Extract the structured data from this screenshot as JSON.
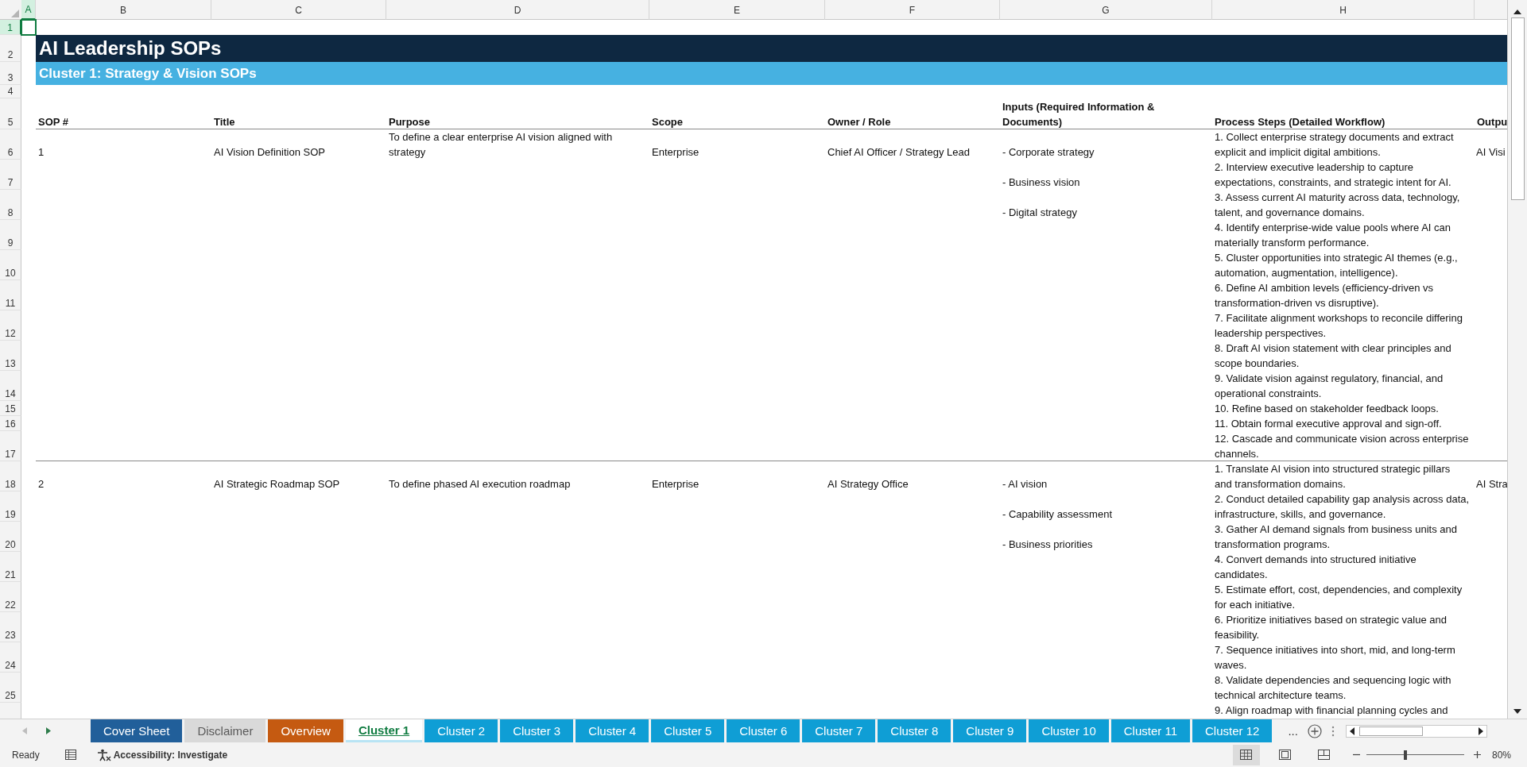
{
  "columns": [
    {
      "label": "A",
      "selected": true
    },
    {
      "label": "B",
      "selected": false
    },
    {
      "label": "C",
      "selected": false
    },
    {
      "label": "D",
      "selected": false
    },
    {
      "label": "E",
      "selected": false
    },
    {
      "label": "F",
      "selected": false
    },
    {
      "label": "G",
      "selected": false
    },
    {
      "label": "H",
      "selected": false
    }
  ],
  "rows": [
    {
      "label": "1",
      "selected": true
    },
    {
      "label": "2",
      "selected": false
    },
    {
      "label": "3",
      "selected": false
    },
    {
      "label": "4",
      "selected": false
    },
    {
      "label": "5",
      "selected": false
    },
    {
      "label": "6",
      "selected": false
    },
    {
      "label": "7",
      "selected": false
    },
    {
      "label": "8",
      "selected": false
    },
    {
      "label": "9",
      "selected": false
    },
    {
      "label": "10",
      "selected": false
    },
    {
      "label": "11",
      "selected": false
    },
    {
      "label": "12",
      "selected": false
    },
    {
      "label": "13",
      "selected": false
    },
    {
      "label": "14",
      "selected": false
    },
    {
      "label": "15",
      "selected": false
    },
    {
      "label": "16",
      "selected": false
    },
    {
      "label": "17",
      "selected": false
    },
    {
      "label": "18",
      "selected": false
    },
    {
      "label": "19",
      "selected": false
    },
    {
      "label": "20",
      "selected": false
    },
    {
      "label": "21",
      "selected": false
    },
    {
      "label": "22",
      "selected": false
    },
    {
      "label": "23",
      "selected": false
    },
    {
      "label": "24",
      "selected": false
    },
    {
      "label": "25",
      "selected": false
    }
  ],
  "title": "AI Leadership SOPs",
  "subtitle": "Cluster 1: Strategy & Vision SOPs",
  "table": {
    "columns": [
      "SOP #",
      "Title",
      "Purpose",
      "Scope",
      "Owner / Role",
      "Inputs (Required Information & Documents)",
      "Process Steps (Detailed Workflow)",
      "Outpu"
    ],
    "records": [
      {
        "sop": "1",
        "title": "AI Vision Definition SOP",
        "purpose": "To define a clear enterprise AI vision aligned with strategy",
        "scope": "Enterprise",
        "owner": "Chief AI Officer / Strategy Lead",
        "inputs": [
          "- Corporate strategy",
          "- Business vision",
          "- Digital strategy"
        ],
        "steps": [
          "1. Collect enterprise strategy documents and extract explicit and implicit digital ambitions.",
          "2. Interview executive leadership to capture expectations, constraints, and strategic intent for AI.",
          "3. Assess current AI maturity across data, technology, talent, and governance domains.",
          "4. Identify enterprise-wide value pools where AI can materially transform performance.",
          "5. Cluster opportunities into strategic AI themes (e.g., automation, augmentation, intelligence).",
          "6. Define AI ambition levels (efficiency-driven vs transformation-driven vs disruptive).",
          "7. Facilitate alignment workshops to reconcile differing leadership perspectives.",
          "8. Draft AI vision statement with clear principles and scope boundaries.",
          "9. Validate vision against regulatory, financial, and operational constraints.",
          "10. Refine based on stakeholder feedback loops.",
          "11. Obtain formal executive approval and sign-off.",
          "12. Cascade and communicate vision across enterprise channels."
        ],
        "column_9": "AI Visi"
      },
      {
        "sop": "2",
        "title": "AI Strategic Roadmap SOP",
        "purpose": "To define phased AI execution roadmap",
        "scope": "Enterprise",
        "owner": "AI Strategy Office",
        "inputs": [
          "- AI vision",
          "- Capability assessment",
          "- Business priorities"
        ],
        "steps": [
          "1. Translate AI vision into structured strategic pillars and transformation domains.",
          "2. Conduct detailed capability gap analysis across data, infrastructure, skills, and governance.",
          "3. Gather AI demand signals from business units and transformation programs.",
          "4. Convert demands into structured initiative candidates.",
          "5. Estimate effort, cost, dependencies, and complexity for each initiative.",
          "6. Prioritize initiatives based on strategic value and feasibility.",
          "7. Sequence initiatives into short, mid, and long-term waves.",
          "8. Validate dependencies and sequencing logic with technical architecture teams.",
          "9. Align roadmap with financial planning cycles and"
        ],
        "column_9": "AI Stra"
      }
    ]
  },
  "sheet_tabs": [
    {
      "label": "Cover Sheet",
      "color": "#215f9a",
      "selected": false
    },
    {
      "label": "Disclaimer",
      "color": "#d9d9d9",
      "selected": false
    },
    {
      "label": "Overview",
      "color": "#c55a11",
      "selected": false
    },
    {
      "label": "Cluster 1",
      "color": "#b8e4f4",
      "selected": true
    },
    {
      "label": "Cluster 2",
      "color": "#0f9ed5",
      "selected": false
    },
    {
      "label": "Cluster 3",
      "color": "#0f9ed5",
      "selected": false
    },
    {
      "label": "Cluster 4",
      "color": "#0f9ed5",
      "selected": false
    },
    {
      "label": "Cluster 5",
      "color": "#0f9ed5",
      "selected": false
    },
    {
      "label": "Cluster 6",
      "color": "#0f9ed5",
      "selected": false
    },
    {
      "label": "Cluster 7",
      "color": "#0f9ed5",
      "selected": false
    },
    {
      "label": "Cluster 8",
      "color": "#0f9ed5",
      "selected": false
    },
    {
      "label": "Cluster 9",
      "color": "#0f9ed5",
      "selected": false
    },
    {
      "label": "Cluster 10",
      "color": "#0f9ed5",
      "selected": false
    },
    {
      "label": "Cluster 11",
      "color": "#0f9ed5",
      "selected": false
    },
    {
      "label": "Cluster 12",
      "color": "#0f9ed5",
      "selected": false
    }
  ],
  "more_tabs": "...",
  "status_bar": {
    "status": "Ready",
    "accessibility": "Accessibility: Investigate",
    "views": [
      {
        "kind": "normal",
        "selected": true
      },
      {
        "kind": "page_layout",
        "selected": false
      },
      {
        "kind": "page_break",
        "selected": false
      }
    ],
    "zoom": {
      "level": 0.4,
      "reading": "80%"
    }
  }
}
